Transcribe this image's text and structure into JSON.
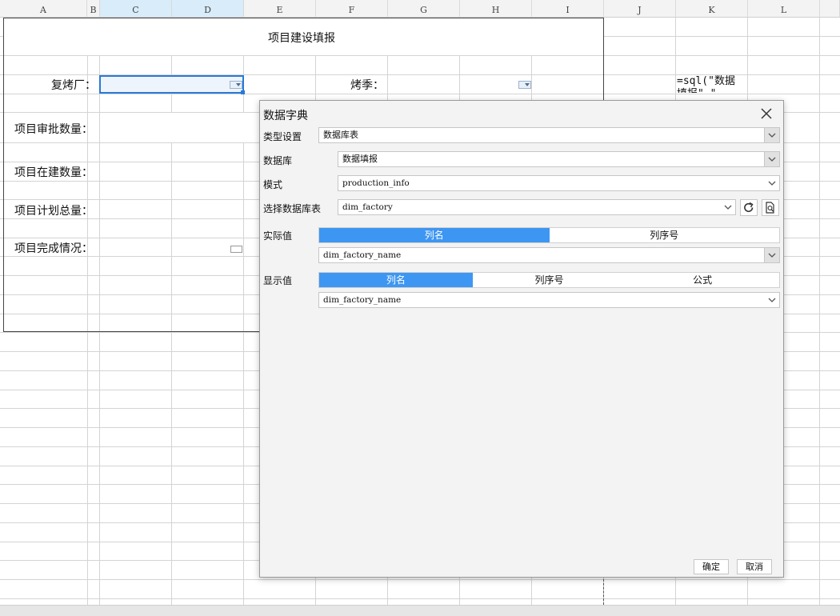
{
  "spreadsheet": {
    "columns": [
      "A",
      "B",
      "C",
      "D",
      "E",
      "F",
      "G",
      "H",
      "I",
      "J",
      "K",
      "L"
    ],
    "form": {
      "title": "项目建设填报",
      "factory_label": "复烤厂：",
      "season_label": "烤季：",
      "approved_label": "项目审批数量：",
      "in_progress_label": "项目在建数量：",
      "planned_label": "项目计划总量：",
      "completion_label": "项目完成情况："
    },
    "formula_cell": "=sql(\"数据\n填报\",\""
  },
  "dialog": {
    "title": "数据字典",
    "type_label": "类型设置",
    "type_value": "数据库表",
    "database_label": "数据库",
    "database_value": "数据填报",
    "schema_label": "模式",
    "schema_value": "production_info",
    "table_label": "选择数据库表",
    "table_value": "dim_factory",
    "actual_label": "实际值",
    "actual_tabs": [
      "列名",
      "列序号"
    ],
    "actual_value": "dim_factory_name",
    "display_label": "显示值",
    "display_tabs": [
      "列名",
      "列序号",
      "公式"
    ],
    "display_value": "dim_factory_name",
    "ok_label": "确定",
    "cancel_label": "取消"
  },
  "colors": {
    "accent": "#3d96f2",
    "selection": "#2a7ad6",
    "header_selected": "#d8ecf9"
  }
}
